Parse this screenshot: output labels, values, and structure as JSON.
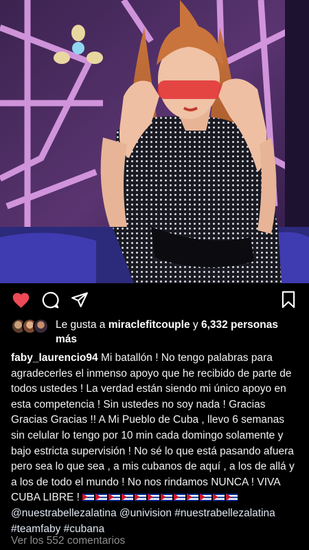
{
  "post": {
    "liked_by_prefix": "Le gusta a ",
    "liked_by_user": "miraclefitcouple",
    "liked_by_connector": " y ",
    "likes_count": "6,332 personas más",
    "author": "faby_laurencio94",
    "caption_main": "Mi batallón ! No tengo palabras para agradecerles el inmenso apoyo que he recibido de parte de todos ustedes ! La verdad están siendo mi único apoyo en esta competencia ! Sin ustedes no soy nada ! Gracias Gracias Gracias !! A Mi Pueblo de Cuba , llevo 6 semanas sin celular lo tengo por 10 min cada domingo solamente y bajo estricta supervisión ! No sé lo que está pasando afuera pero sea lo que sea , a mis cubanos de aquí , a los de allá y a los de todo el mundo ! No nos rindamos NUNCA ! VIVA CUBA LIBRE !",
    "flag_count": 12,
    "mention1": "@nuestrabellezalatina",
    "mention2": "@univision",
    "hashtags": "#nuestrabellezalatina #teamfaby #cubana",
    "view_comments": "Ver los 552 comentarios"
  },
  "icons": {
    "like": "heart-icon-filled",
    "comment": "comment-icon",
    "share": "send-icon",
    "save": "bookmark-icon"
  },
  "colors": {
    "like": "#ed4956",
    "muted": "#8e8e8e",
    "background": "#000000"
  }
}
